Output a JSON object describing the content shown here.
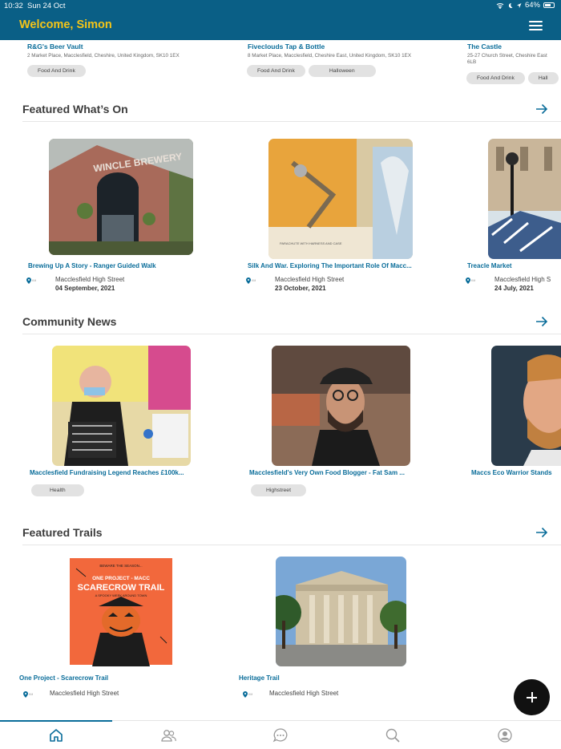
{
  "status": {
    "time": "10:32",
    "date": "Sun 24 Oct",
    "battery": "64%"
  },
  "header": {
    "welcome": "Welcome, Simon"
  },
  "venues": [
    {
      "name": "R&G's Beer Vault",
      "address": "2 Market Place, Macclesfield, Cheshire, United Kingdom, SK10 1EX",
      "tags": [
        "Food And Drink"
      ]
    },
    {
      "name": "Fiveclouds Tap & Bottle",
      "address": "8 Market Place, Macclesfield, Cheshire East, United Kingdom, SK10 1EX",
      "tags": [
        "Food And Drink",
        "Halloween"
      ]
    },
    {
      "name": "The Castle",
      "address_line1": "25-27 Church Street, Cheshire East",
      "address_line2": "6LB",
      "tags": [
        "Food And Drink",
        "Hall"
      ]
    }
  ],
  "featured_whats_on": {
    "title": "Featured What’s On",
    "items": [
      {
        "title": "Brewing Up A Story - Ranger Guided Walk",
        "location": "Macclesfield High Street",
        "date": "04 September, 2021",
        "image_text": "WINCLE BREWERY"
      },
      {
        "title": "Silk And War. Exploring The Important Role Of Macc...",
        "location": "Macclesfield High Street",
        "date": "23 October, 2021"
      },
      {
        "title": "Treacle Market",
        "location": "Macclesfield High S",
        "date": "24 July, 2021"
      }
    ]
  },
  "community_news": {
    "title": "Community News",
    "items": [
      {
        "title": "Macclesfield Fundraising Legend Reaches £100k...",
        "tag": "Health"
      },
      {
        "title": "Macclesfield's Very Own Food Blogger - Fat Sam ...",
        "tag": "Highstreet"
      },
      {
        "title": "Maccs Eco Warrior Stands"
      }
    ]
  },
  "featured_trails": {
    "title": "Featured Trails",
    "items": [
      {
        "title": "One Project - Scarecrow Trail",
        "location": "Macclesfield High Street",
        "poster_top": "BEWARE THE SEASON...",
        "poster_sub": "ONE PROJECT - MACC",
        "poster_main": "SCARECROW TRAIL",
        "poster_tag": "A SPOOKY WEEK AROUND TOWN"
      },
      {
        "title": "Heritage Trail",
        "location": "Macclesfield High Street"
      }
    ]
  },
  "tabs": [
    "home-icon",
    "people-icon",
    "chat-icon",
    "search-icon",
    "profile-icon"
  ],
  "colors": {
    "header": "#0a5f86",
    "accent": "#f5c518",
    "link": "#0a6d9a"
  }
}
